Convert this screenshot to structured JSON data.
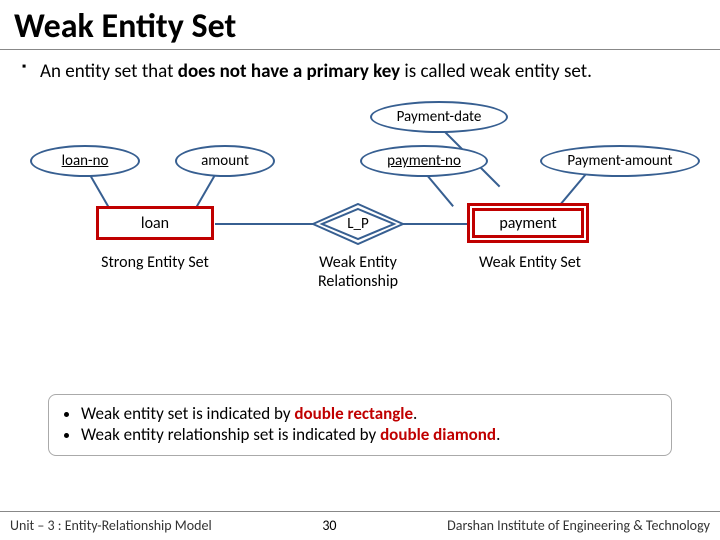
{
  "title": "Weak Entity Set",
  "definition_pre": "An entity set that ",
  "definition_bold": "does not have a primary key",
  "definition_post": " is called weak entity set.",
  "attrs": {
    "loan_no": "loan-no",
    "amount": "amount",
    "payment_date": "Payment-date",
    "payment_no": "payment-no",
    "payment_amount": "Payment-amount"
  },
  "entities": {
    "loan": "loan",
    "payment": "payment",
    "rel": "L_P"
  },
  "captions": {
    "strong": "Strong Entity Set",
    "weak_rel": "Weak Entity Relationship",
    "weak_set": "Weak Entity Set"
  },
  "notes": {
    "n1_pre": "Weak entity set is indicated by ",
    "n1_bold": "double rectangle",
    "n2_pre": "Weak entity relationship set is indicated by ",
    "n2_bold": "double diamond"
  },
  "footer": {
    "left": "Unit – 3 : Entity-Relationship Model",
    "page": "30",
    "right": "Darshan Institute of Engineering & Technology"
  }
}
